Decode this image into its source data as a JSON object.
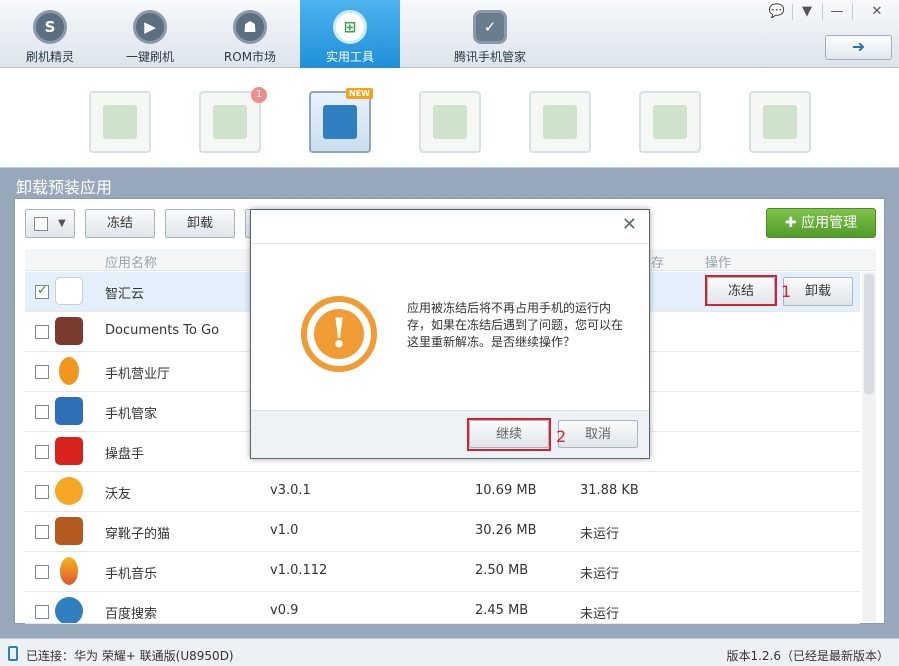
{
  "nav": [
    {
      "label": "刷机精灵",
      "icon": "brush-logo-icon"
    },
    {
      "label": "一键刷机",
      "icon": "play-icon"
    },
    {
      "label": "ROM市场",
      "icon": "android-icon"
    },
    {
      "label": "实用工具",
      "icon": "grid-icon",
      "active": true
    },
    {
      "label": "腾讯手机管家",
      "icon": "shield-icon"
    }
  ],
  "section_title": "卸载预装应用",
  "toolbar": {
    "freeze": "冻结",
    "uninstall": "卸载",
    "app_manage": "应用管理"
  },
  "table": {
    "headers": {
      "name": "应用名称",
      "storage": "存",
      "action": "操作"
    },
    "rows": [
      {
        "name": "智汇云",
        "version": "",
        "size": "",
        "memory": "",
        "checked": true
      },
      {
        "name": "Documents To Go",
        "version": "",
        "size": "",
        "memory": ""
      },
      {
        "name": "手机营业厅",
        "version": "",
        "size": "",
        "memory": ""
      },
      {
        "name": "手机管家",
        "version": "",
        "size": "",
        "memory": ""
      },
      {
        "name": "操盘手",
        "version": "",
        "size": "",
        "memory": ""
      },
      {
        "name": "沃友",
        "version": "v3.0.1",
        "size": "10.69 MB",
        "memory": "31.88 KB"
      },
      {
        "name": "穿靴子的猫",
        "version": "v1.0",
        "size": "30.26 MB",
        "memory": "未运行"
      },
      {
        "name": "手机音乐",
        "version": "v1.0.112",
        "size": "2.50 MB",
        "memory": "未运行"
      },
      {
        "name": "百度搜索",
        "version": "v0.9",
        "size": "2.45 MB",
        "memory": "未运行"
      }
    ],
    "row_actions": {
      "freeze": "冻结",
      "uninstall": "卸载"
    }
  },
  "annotations": {
    "mark1": "1",
    "mark2": "2"
  },
  "dialog": {
    "message": "应用被冻结后将不再占用手机的运行内存，如果在冻结后遇到了问题，您可以在这里重新解冻。是否继续操作？",
    "continue": "继续",
    "cancel": "取消"
  },
  "status": {
    "connection": "已连接：华为 荣耀+ 联通版(U8950D)",
    "version": "版本1.2.6（已经是最新版本）"
  },
  "colors": {
    "accent": "#2f90d8",
    "warning": "#f19b35",
    "highlight": "#d7222b",
    "green": "#5aa631"
  }
}
